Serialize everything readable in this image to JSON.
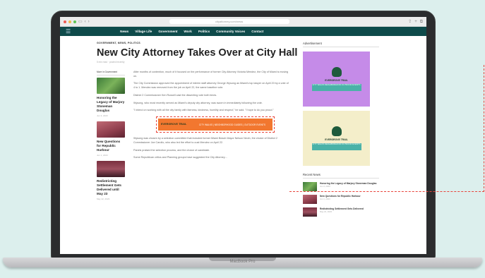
{
  "browser": {
    "url": "cityattorney.com/news",
    "colors": {
      "close": "#ee5a52",
      "minimize": "#f3bd4f",
      "maximize": "#5fc454"
    }
  },
  "nav": {
    "items": [
      "News",
      "Village Life",
      "Government",
      "Work",
      "Politics",
      "Community Voices",
      "Contact"
    ],
    "background": "#0e4a4a"
  },
  "article": {
    "categories": "GOVERNMENT, NEWS, POLITICS",
    "title": "New City Attorney Takes Over at City Hall",
    "byline": "5 min read · posted recently",
    "paragraphs": [
      "After months of contention, much of it focused on the performance of former City Attorney Victoria Mendez, the City of Miami is moving on.",
      "The City Commission approved the appointment of interim staff attorney George Wysong as Miami's top lawyer on April 20 by a vote of 4 to 1. Mendez was removed from the job on April 22, the same baseline vote.",
      "District 2 Commissioner Ken Russell cast the dissenting vote both times.",
      "Wysong, who most recently served as Miami's deputy city attorney, was sworn in immediately following the vote.",
      "\"I intend on working with all the city family with fairness, kindness, humility and respect,\" he said. \"I hope to do you proud.\"",
      "Wysong was chosen by a selection committee that included former Miami Beach Mayor Nelson Nevin, the choice of District 2 Commissioner Joe Carollo, who also led the effort to oust Mendez on April 22.",
      "Panels praised the selection process, and the choice of candidate.",
      "Some Republican critics and Planning groups have suggested the City Attorney…"
    ]
  },
  "promo": {
    "brand": "EVERGROVE TRAIL",
    "text": "CITY WALKS | NEIGHBORHOOD GUIDES | OUTDOOR EVENTS"
  },
  "left_column": {
    "header": "More in Government",
    "items": [
      {
        "title": "Honoring the Legacy of Marjory Stoneman Douglas",
        "date": "Jun 3, 2023"
      },
      {
        "title": "New Questions for Republic Harbour",
        "date": "Jun 1, 2023"
      },
      {
        "title": "Redistricting Settlement Gets Delivered until May 23",
        "date": "May 22, 2023"
      }
    ]
  },
  "sidebar": {
    "advert_header": "Advertisement",
    "ads": [
      {
        "brand": "EVERGROVE TRAIL",
        "caption": "CITY WALKS NEIGHBORHOOD OUTDOOR EVENTS",
        "bg": "#c58be8"
      },
      {
        "brand": "EVERGROVE TRAIL",
        "caption": "CITY WALKS NEIGHBORHOOD OUTDOOR EVENTS",
        "bg": "#f4eeca"
      }
    ],
    "recent_header": "Recent News",
    "recent": [
      {
        "title": "Honoring the Legacy of Marjory Stoneman Douglas",
        "meta": "Jun 3, 2023"
      },
      {
        "title": "New Questions for Republic Harbour",
        "meta": "Jun 1, 2023"
      },
      {
        "title": "Redistricting Settlement Gets Delivered",
        "meta": "May 22, 2023"
      }
    ]
  },
  "device_label": "MacBook Pro"
}
